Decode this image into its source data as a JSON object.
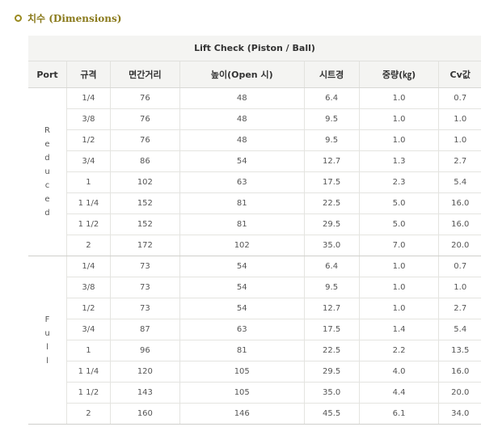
{
  "section": {
    "title": "치수 (Dimensions)"
  },
  "table": {
    "title": "Lift Check (Piston / Ball)",
    "headers": [
      "Port",
      "규격",
      "면간거리",
      "높이(Open 시)",
      "시트경",
      "중량(㎏)",
      "Cv값"
    ],
    "groups": [
      {
        "port": "Reduced",
        "rows": [
          [
            "1/4",
            "76",
            "48",
            "6.4",
            "1.0",
            "0.7"
          ],
          [
            "3/8",
            "76",
            "48",
            "9.5",
            "1.0",
            "1.0"
          ],
          [
            "1/2",
            "76",
            "48",
            "9.5",
            "1.0",
            "1.0"
          ],
          [
            "3/4",
            "86",
            "54",
            "12.7",
            "1.3",
            "2.7"
          ],
          [
            "1",
            "102",
            "63",
            "17.5",
            "2.3",
            "5.4"
          ],
          [
            "1 1/4",
            "152",
            "81",
            "22.5",
            "5.0",
            "16.0"
          ],
          [
            "1 1/2",
            "152",
            "81",
            "29.5",
            "5.0",
            "16.0"
          ],
          [
            "2",
            "172",
            "102",
            "35.0",
            "7.0",
            "20.0"
          ]
        ]
      },
      {
        "port": "Full",
        "rows": [
          [
            "1/4",
            "73",
            "54",
            "6.4",
            "1.0",
            "0.7"
          ],
          [
            "3/8",
            "73",
            "54",
            "9.5",
            "1.0",
            "1.0"
          ],
          [
            "1/2",
            "73",
            "54",
            "12.7",
            "1.0",
            "2.7"
          ],
          [
            "3/4",
            "87",
            "63",
            "17.5",
            "1.4",
            "5.4"
          ],
          [
            "1",
            "96",
            "81",
            "22.5",
            "2.2",
            "13.5"
          ],
          [
            "1 1/4",
            "120",
            "105",
            "29.5",
            "4.0",
            "16.0"
          ],
          [
            "1 1/2",
            "143",
            "105",
            "35.0",
            "4.4",
            "20.0"
          ],
          [
            "2",
            "160",
            "146",
            "45.5",
            "6.1",
            "34.0"
          ]
        ]
      }
    ]
  }
}
